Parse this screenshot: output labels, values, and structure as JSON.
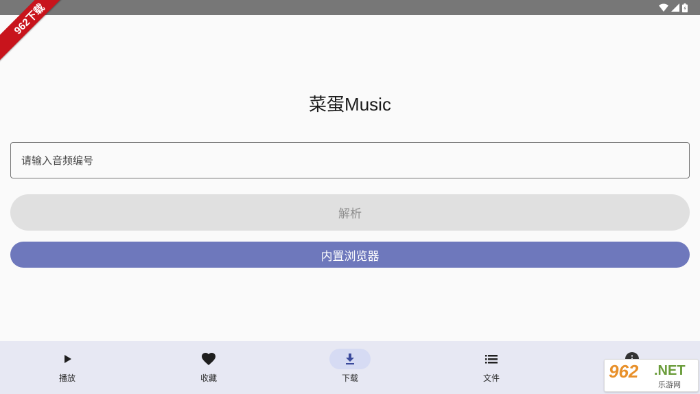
{
  "corner_badge": {
    "text": "962下载"
  },
  "app": {
    "title": "菜蛋Music"
  },
  "search": {
    "placeholder": "请输入音频编号",
    "value": ""
  },
  "buttons": {
    "parse": "解析",
    "browser": "内置浏览器"
  },
  "bottom_nav": {
    "items": [
      {
        "label": "播放",
        "icon": "play-icon",
        "active": false
      },
      {
        "label": "收藏",
        "icon": "heart-icon",
        "active": false
      },
      {
        "label": "下载",
        "icon": "download-icon",
        "active": true
      },
      {
        "label": "文件",
        "icon": "list-icon",
        "active": false
      },
      {
        "label": "",
        "icon": "info-icon",
        "active": false
      }
    ]
  },
  "watermark": {
    "number": "962",
    "net": ".NET",
    "name": "乐游网"
  },
  "colors": {
    "accent": "#6e78bc",
    "status_bar": "#777777",
    "nav_background": "#e7e8f3",
    "nav_active_pill": "#d6dbf3",
    "disabled_button": "#e0e0e0"
  }
}
